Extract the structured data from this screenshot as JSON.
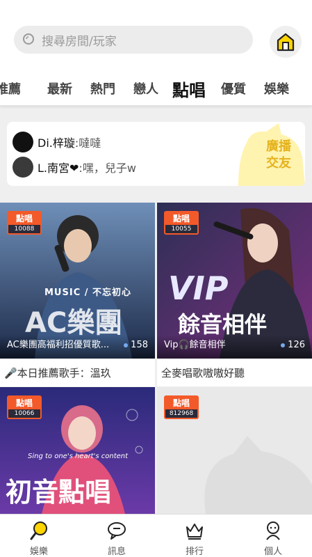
{
  "search": {
    "placeholder": "搜尋房間/玩家"
  },
  "tabs": [
    {
      "label": "推薦"
    },
    {
      "label": "最新"
    },
    {
      "label": "熱門"
    },
    {
      "label": "戀人"
    },
    {
      "label": "點唱"
    },
    {
      "label": "優質"
    },
    {
      "label": "娛樂"
    }
  ],
  "broadcast": {
    "messages": [
      {
        "name": "Di.梓璇",
        "text": ":噠噠"
      },
      {
        "name": "L.南宮❤",
        "text": ":嘿，兒子w"
      }
    ],
    "cta_line1": "廣播",
    "cta_line2": "交友"
  },
  "rooms": [
    {
      "badge": "點唱",
      "id": "10088",
      "title": "AC樂團高福利招優質歌...",
      "count": "158",
      "caption": "🎤本日推薦歌手：溫玖",
      "art_text": "AC樂團",
      "art_sub": "MUSIC / 不忘初心"
    },
    {
      "badge": "點唱",
      "id": "10055",
      "title": "Vip🎧餘音相伴",
      "count": "126",
      "caption": "全麥唱歌嗷嗷好聽",
      "art_text": "餘音相伴",
      "art_sub": "VIP"
    },
    {
      "badge": "點唱",
      "id": "10066",
      "art_text": "初音點唱",
      "art_sub": "Sing to one's heart's content"
    },
    {
      "badge": "點唱",
      "id": "812968"
    }
  ],
  "bottom_nav": [
    {
      "label": "娛樂",
      "icon": "microphone-icon"
    },
    {
      "label": "訊息",
      "icon": "chat-icon"
    },
    {
      "label": "排行",
      "icon": "crown-icon"
    },
    {
      "label": "個人",
      "icon": "person-icon"
    }
  ],
  "colors": {
    "accent": "#ffe21a",
    "badge": "#f35a2a",
    "gold": "#e5b21d"
  }
}
